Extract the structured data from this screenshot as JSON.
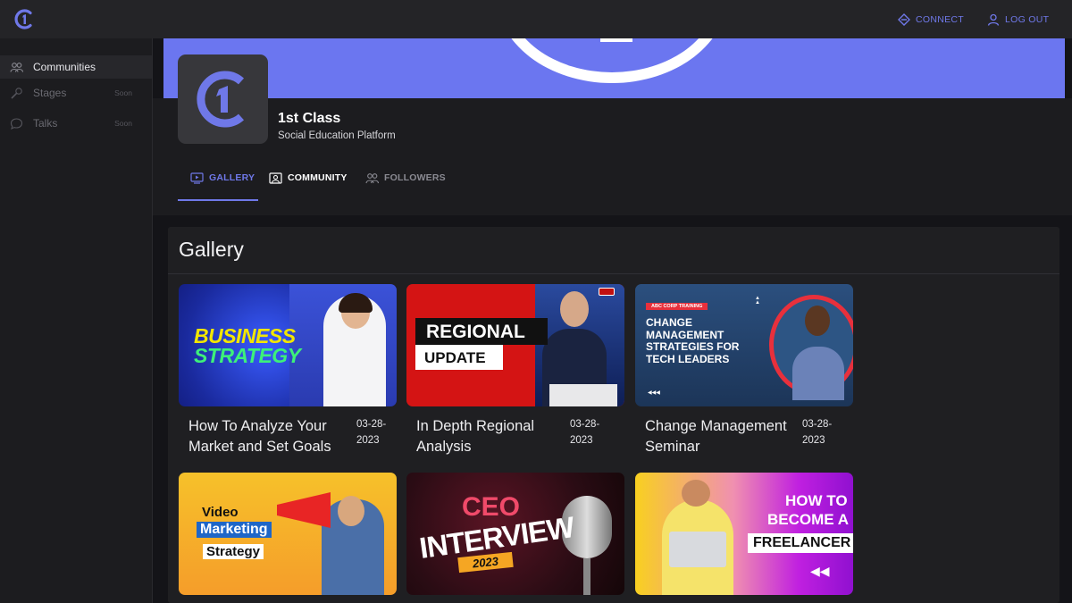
{
  "topbar": {
    "connect_label": "CONNECT",
    "logout_label": "LOG OUT",
    "accent": "#6f78e8"
  },
  "sidebar": {
    "items": [
      {
        "label": "Communities",
        "badge": ""
      },
      {
        "label": "Stages",
        "badge": "Soon"
      },
      {
        "label": "Talks",
        "badge": "Soon"
      }
    ]
  },
  "profile": {
    "name": "1st Class",
    "tagline": "Social Education Platform",
    "banner_color": "#6b76f0"
  },
  "tabs": [
    {
      "label": "GALLERY",
      "active": true
    },
    {
      "label": "COMMUNITY",
      "active": false
    },
    {
      "label": "FOLLOWERS",
      "active": false
    }
  ],
  "gallery": {
    "title": "Gallery",
    "videos": [
      {
        "title": "How To Analyze Your Market and Set Goals",
        "date": "03-28-2023",
        "thumb_text": [
          "BUSINESS",
          "STRATEGY"
        ]
      },
      {
        "title": "In Depth Regional Analysis",
        "date": "03-28-2023",
        "thumb_text": [
          "REGIONAL",
          "UPDATE"
        ]
      },
      {
        "title": "Change Management Seminar",
        "date": "03-28-2023",
        "thumb_text": [
          "ABC CORP TRAINING",
          "CHANGE MANAGEMENT STRATEGIES FOR TECH LEADERS"
        ]
      },
      {
        "title": "",
        "date": "",
        "thumb_text": [
          "Video",
          "Marketing",
          "Strategy"
        ]
      },
      {
        "title": "",
        "date": "",
        "thumb_text": [
          "CEO",
          "INTERVIEW",
          "2023"
        ]
      },
      {
        "title": "",
        "date": "",
        "thumb_text": [
          "HOW TO",
          "BECOME A",
          "FREELANCER"
        ]
      }
    ]
  }
}
